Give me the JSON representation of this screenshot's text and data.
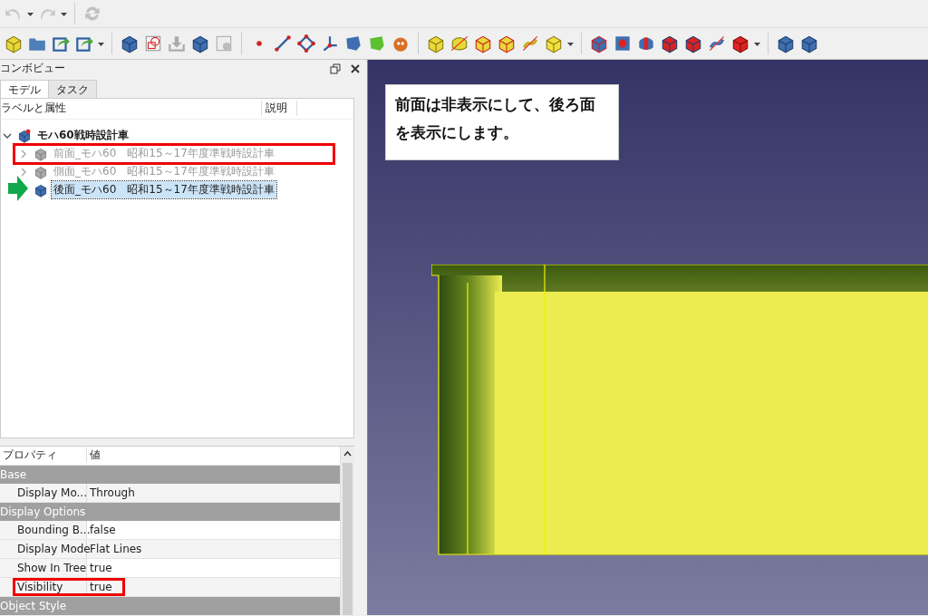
{
  "combo_view": {
    "title": "コンボビュー",
    "tabs": [
      {
        "label": "モデル",
        "selected": true
      },
      {
        "label": "タスク",
        "selected": false
      }
    ],
    "tree": {
      "columns": [
        "ラベルと属性",
        "説明"
      ],
      "items": [
        {
          "label": "モハ60戦時設計車",
          "expanded": true,
          "children": [
            {
              "label": "前面_モハ60　昭和15～17年度準戦時設計車",
              "visible": false,
              "selected": false,
              "highlighted": true,
              "pointed": false
            },
            {
              "label": "側面_モハ60　昭和15～17年度準戦時設計車",
              "visible": false,
              "selected": false,
              "highlighted": false,
              "pointed": false
            },
            {
              "label": "後面_モハ60　昭和15～17年度準戦時設計車",
              "visible": true,
              "selected": true,
              "highlighted": false,
              "pointed": true
            }
          ]
        }
      ]
    }
  },
  "properties": {
    "columns": [
      "プロパティ",
      "値"
    ],
    "groups": [
      {
        "name": "Base",
        "rows": [
          {
            "property": "Display Mo...",
            "value": "Through",
            "highlighted": false
          }
        ]
      },
      {
        "name": "Display Options",
        "rows": [
          {
            "property": "Bounding B...",
            "value": "false",
            "highlighted": false
          },
          {
            "property": "Display Mode",
            "value": "Flat Lines",
            "highlighted": false
          },
          {
            "property": "Show In Tree",
            "value": "true",
            "highlighted": false
          },
          {
            "property": "Visibility",
            "value": "true",
            "highlighted": true
          }
        ]
      },
      {
        "name": "Object Style"
      }
    ]
  },
  "viewport": {
    "note": "前面は非表示にして、後ろ面を表示にします。"
  }
}
